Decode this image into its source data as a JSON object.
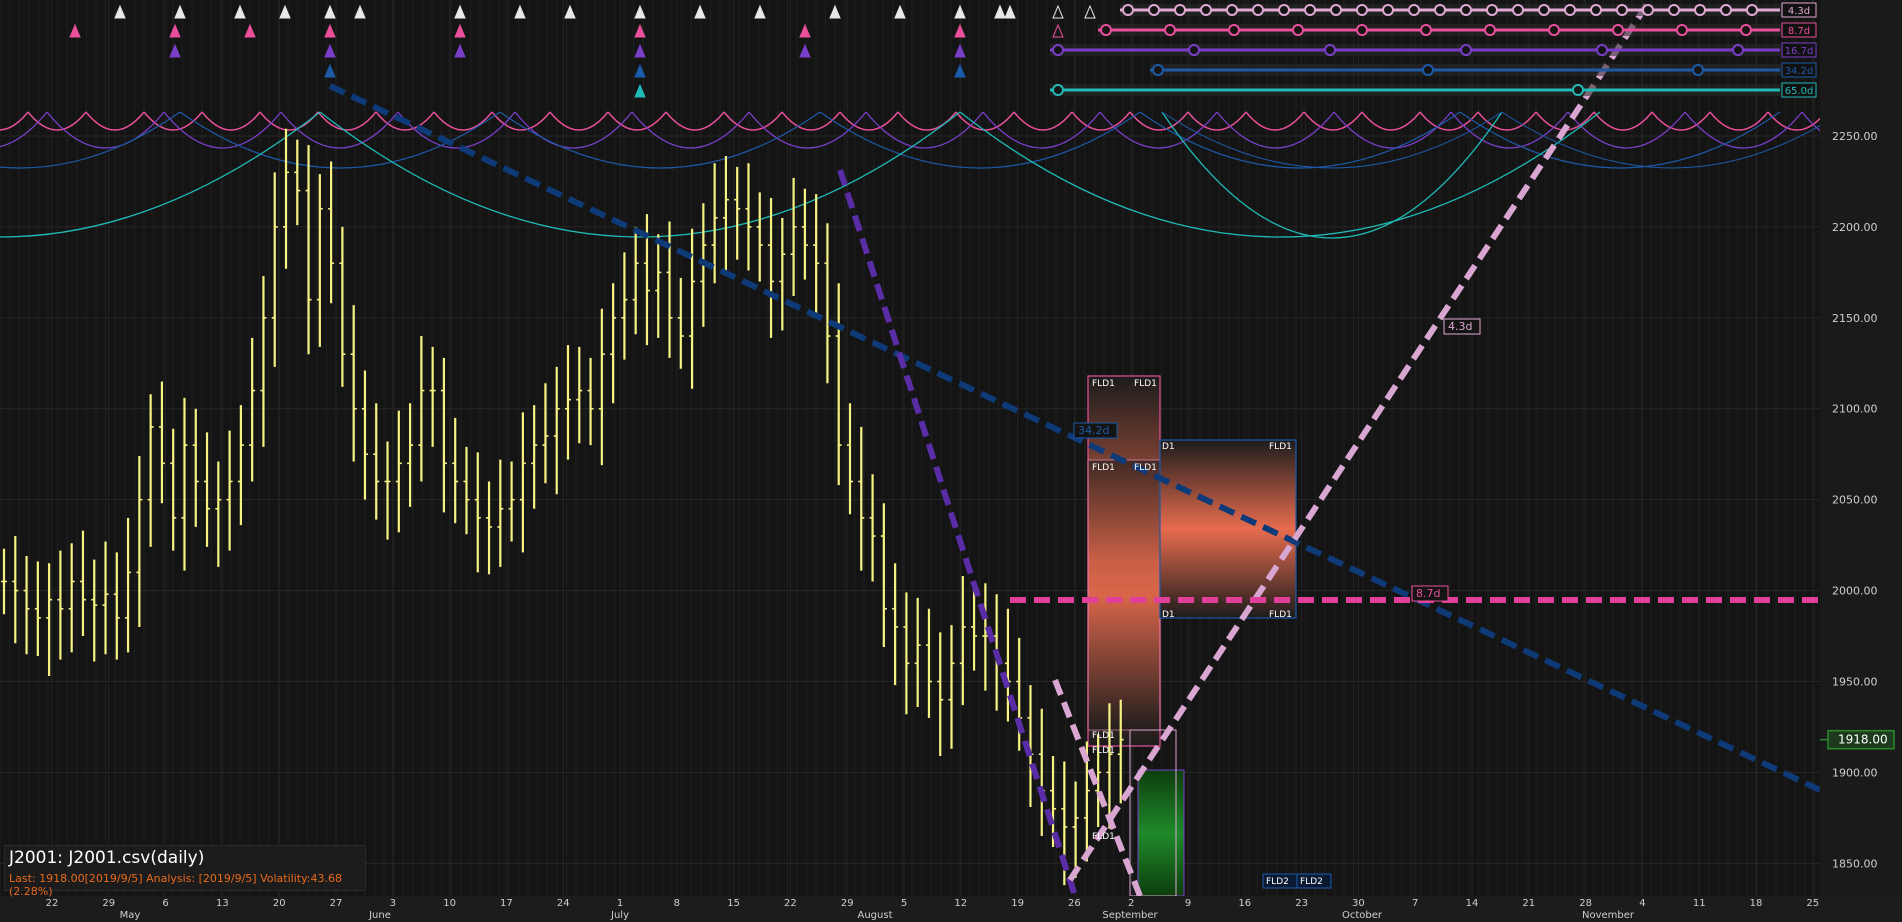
{
  "instrument": {
    "title": "J2001: J2001.csv(daily)",
    "info_line": "Last: 1918.00[2019/9/5] Analysis: [2019/9/5] Volatility:43.68 (2.28%)"
  },
  "colors": {
    "background": "#141414",
    "price_bar": "#f7f383",
    "c4_3d": "#e0a8d4",
    "c8_7d": "#e94f9a",
    "c16_7d": "#7a3fc9",
    "c34_2d": "#1d5aa8",
    "c65_0d": "#1fbab6",
    "trend_blue": "#0e3a78",
    "trend_purple": "#5a2ca6",
    "trend_pink": "#d9a6d2",
    "trend_magenta": "#e0409a",
    "last_price_box": "#2b8a2b"
  },
  "chart_data": {
    "type": "bar",
    "title": "J2001: J2001.csv(daily)",
    "ylim": [
      1835,
      2305
    ],
    "y_ticks": [
      "2250.00",
      "2200.00",
      "2150.00",
      "2100.00",
      "2050.00",
      "2000.00",
      "1950.00",
      "1900.00",
      "1850.00"
    ],
    "last_price_label": "1918.00",
    "last_price": 1918,
    "x_day_labels": [
      "22",
      "29",
      "6",
      "13",
      "20",
      "27",
      "3",
      "10",
      "17",
      "24",
      "1",
      "8",
      "15",
      "22",
      "29",
      "5",
      "12",
      "19",
      "26",
      "2",
      "9",
      "16",
      "23",
      "30",
      "7",
      "14",
      "21",
      "28",
      "4",
      "11",
      "18",
      "25"
    ],
    "x_month_labels": [
      "May",
      "June",
      "July",
      "August",
      "September",
      "October",
      "November"
    ],
    "cycles": [
      {
        "name": "4.3d",
        "label": "4.3d"
      },
      {
        "name": "8.7d",
        "label": "8.7d"
      },
      {
        "name": "16.7d",
        "label": "16.7d"
      },
      {
        "name": "34.2d",
        "label": "34.2d"
      },
      {
        "name": "65.0d",
        "label": "65.0d"
      }
    ],
    "annotations": [
      "4.3d",
      "8.7d",
      "34.2d",
      "FLD1",
      "FLD2",
      "D1"
    ],
    "series": [
      {
        "name": "J2001",
        "ohlc_start": "2019-04-19",
        "close": [
          2005,
          2000,
          1990,
          1985,
          1995,
          1990,
          2005,
          1995,
          1992,
          1998,
          1985,
          2010,
          2050,
          2090,
          2070,
          2040,
          2080,
          2060,
          2045,
          2050,
          2060,
          2080,
          2110,
          2150,
          2200,
          2230,
          2220,
          2160,
          2210,
          2180,
          2130,
          2100,
          2075,
          2060,
          2060,
          2070,
          2080,
          2110,
          2110,
          2070,
          2060,
          2050,
          2040,
          2035,
          2045,
          2050,
          2070,
          2080,
          2085,
          2100,
          2105,
          2110,
          2100,
          2130,
          2150,
          2160,
          2180,
          2165,
          2175,
          2150,
          2140,
          2170,
          2190,
          2205,
          2215,
          2210,
          2200,
          2190,
          2170,
          2185,
          2200,
          2190,
          2180,
          2140,
          2080,
          2060,
          2040,
          2030,
          1990,
          1980,
          1960,
          1970,
          1950,
          1940,
          1960,
          1980,
          1975,
          1975,
          1960,
          1950,
          1930,
          1910,
          1890,
          1880,
          1870,
          1875,
          1890,
          1900,
          1910,
          1918
        ]
      }
    ]
  }
}
